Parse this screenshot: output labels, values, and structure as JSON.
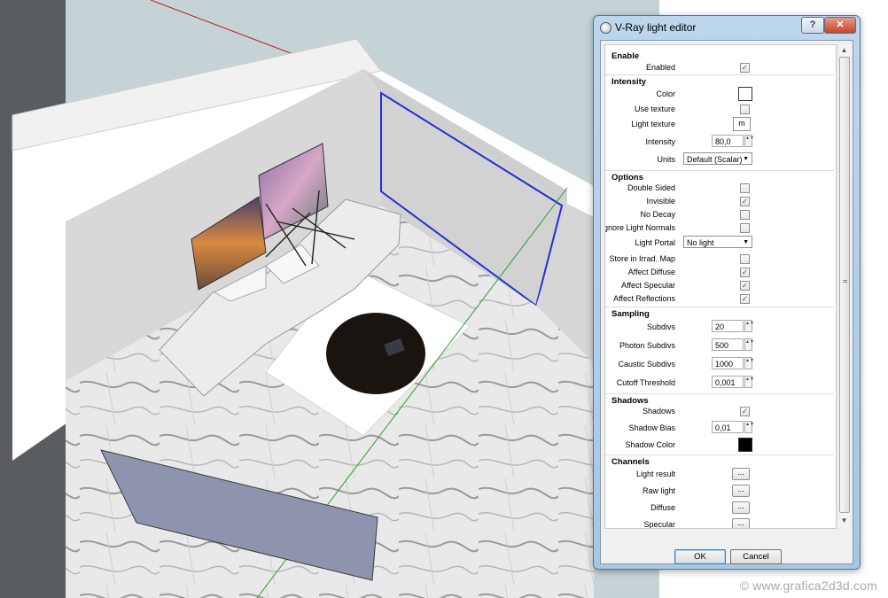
{
  "window": {
    "title": "V-Ray light editor",
    "help_label": "?",
    "close_label": "✕",
    "icon": "vray-icon"
  },
  "sections": {
    "enable": "Enable",
    "intensity": "Intensity",
    "options": "Options",
    "sampling": "Sampling",
    "shadows": "Shadows",
    "channels": "Channels"
  },
  "enable": {
    "enabled_label": "Enabled",
    "enabled_checked": true
  },
  "intensity": {
    "color_label": "Color",
    "color_value": "#ffffff",
    "use_texture_label": "Use texture",
    "use_texture_checked": false,
    "light_texture_label": "Light texture",
    "light_texture_button": "m",
    "intensity_label": "Intensity",
    "intensity_value": "80,0",
    "units_label": "Units",
    "units_value": "Default (Scalar)"
  },
  "options": {
    "double_sided_label": "Double Sided",
    "invisible_label": "Invisible",
    "no_decay_label": "No Decay",
    "ignore_normals_label": "Ignore Light Normals",
    "light_portal_label": "Light Portal",
    "light_portal_value": "No light",
    "store_irrad_label": "Store in Irrad. Map",
    "affect_diffuse_label": "Affect Diffuse",
    "affect_specular_label": "Affect Specular",
    "affect_reflections_label": "Affect Reflections"
  },
  "sampling": {
    "subdivs_label": "Subdivs",
    "subdivs_value": "20",
    "photon_subdivs_label": "Photon Subdivs",
    "photon_subdivs_value": "500",
    "caustic_subdivs_label": "Caustic Subdivs",
    "caustic_subdivs_value": "1000",
    "cutoff_label": "Cutoff Threshold",
    "cutoff_value": "0,001"
  },
  "shadows": {
    "shadows_label": "Shadows",
    "shadows_checked": true,
    "bias_label": "Shadow Bias",
    "bias_value": "0,01",
    "color_label": "Shadow Color",
    "color_value": "#000000"
  },
  "channels": {
    "light_result_label": "Light result",
    "raw_light_label": "Raw light",
    "diffuse_label": "Diffuse",
    "specular_label": "Specular",
    "button_label": "..."
  },
  "footer": {
    "ok_label": "OK",
    "cancel_label": "Cancel"
  },
  "watermark": "© www.grafica2d3d.com",
  "check_glyph": "✓",
  "spin_glyph": "▲▼",
  "dropdown_glyph": "▼"
}
